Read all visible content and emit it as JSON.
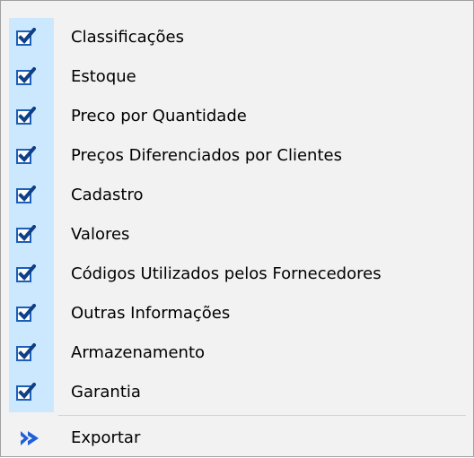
{
  "menu": {
    "items": [
      {
        "label": "Classificações",
        "checked": true
      },
      {
        "label": "Estoque",
        "checked": true
      },
      {
        "label": "Preco por Quantidade",
        "checked": true
      },
      {
        "label": "Preços Diferenciados por Clientes",
        "checked": true
      },
      {
        "label": "Cadastro",
        "checked": true
      },
      {
        "label": "Valores",
        "checked": true
      },
      {
        "label": "Códigos Utilizados pelos Fornecedores",
        "checked": true
      },
      {
        "label": "Outras Informações",
        "checked": true
      },
      {
        "label": "Armazenamento",
        "checked": true
      },
      {
        "label": "Garantia",
        "checked": true
      }
    ],
    "export": {
      "label": "Exportar",
      "icon": "double-arrow-right-icon"
    }
  },
  "colors": {
    "check_highlight": "#cce8ff",
    "check_border": "#1c5fb8",
    "check_mark": "#0f3f86",
    "menu_background": "#f2f2f2",
    "export_arrow": "#1f5fd8"
  },
  "icons": {
    "checkbox": "checkbox-checked-icon"
  }
}
